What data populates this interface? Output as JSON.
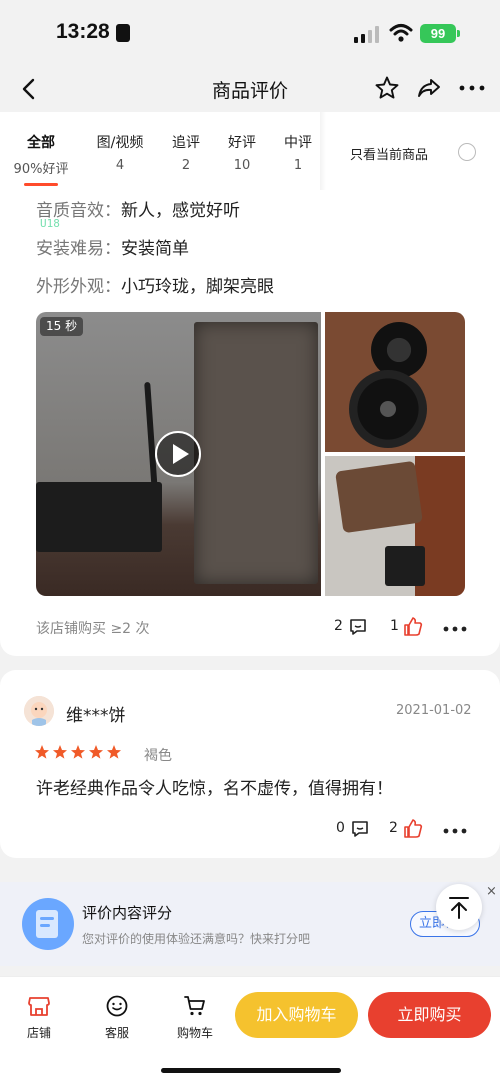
{
  "status_bar": {
    "time": "13:28",
    "battery": "99"
  },
  "nav": {
    "title": "商品评价",
    "icons": [
      "back-icon",
      "star-icon",
      "share-icon",
      "more-icon"
    ]
  },
  "tabs": [
    {
      "label": "全部",
      "count": "90%好评",
      "active": true
    },
    {
      "label": "图/视频",
      "count": "4"
    },
    {
      "label": "追评",
      "count": "2"
    },
    {
      "label": "好评",
      "count": "10"
    },
    {
      "label": "中评",
      "count": "1"
    }
  ],
  "filter": {
    "only_current_label": "只看当前商品"
  },
  "review1": {
    "attributes": [
      {
        "label": "音质音效：",
        "value": "新人，感觉好听"
      },
      {
        "label": "安装难易：",
        "value": "安装简单"
      },
      {
        "label": "外形外观：",
        "value": "小巧玲珑，脚架亮眼"
      }
    ],
    "video_duration": "15 秒",
    "router_display": "U18",
    "purchase_info": "该店铺购买 ≥2 次",
    "comments": "2",
    "likes": "1"
  },
  "review2": {
    "username": "维***饼",
    "date": "2021-01-02",
    "stars": 5,
    "variant": "褐色",
    "text": "许老经典作品令人吃惊，名不虚传，值得拥有！",
    "comments": "0",
    "likes": "2"
  },
  "survey": {
    "title": "评价内容评分",
    "subtitle": "您对评价的使用体验还满意吗？快来打分吧",
    "button": "立即评分",
    "close": "×"
  },
  "bottom_bar": {
    "shop": "店铺",
    "service": "客服",
    "cart": "购物车",
    "add_to_cart": "加入购物车",
    "buy_now": "立即购买"
  },
  "colors": {
    "accent_red": "#e8402f",
    "accent_yellow": "#f5c22e",
    "link_blue": "#3a74e8",
    "star_orange": "#f05a28"
  }
}
